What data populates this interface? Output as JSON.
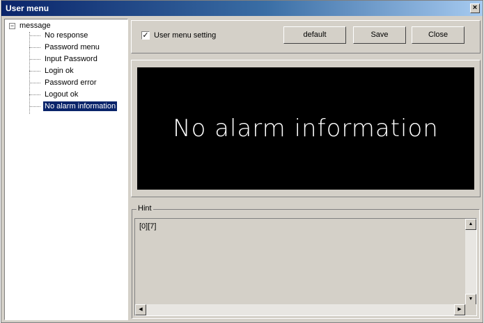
{
  "window": {
    "title": "User menu",
    "close_glyph": "×"
  },
  "tree": {
    "root_label": "message",
    "expander": "−",
    "items": [
      {
        "label": "No response"
      },
      {
        "label": "Password menu"
      },
      {
        "label": "Input Password"
      },
      {
        "label": "Login ok"
      },
      {
        "label": "Password error"
      },
      {
        "label": "Logout ok"
      },
      {
        "label": "No alarm information",
        "selected": true
      }
    ]
  },
  "toolbar": {
    "checkbox_label": "User menu setting",
    "checkbox_checked": true,
    "check_glyph": "✓",
    "default_label": "default",
    "save_label": "Save",
    "close_label": "Close"
  },
  "preview": {
    "text": "No alarm information",
    "background": "#000000",
    "color": "#ffffff"
  },
  "hint": {
    "label": "Hint",
    "value": "[0][7]",
    "up_glyph": "▲",
    "down_glyph": "▼",
    "left_glyph": "◀",
    "right_glyph": "▶"
  },
  "colors": {
    "titlebar": "#0a246a",
    "selection": "#0a246a",
    "face": "#d4d0c8"
  }
}
